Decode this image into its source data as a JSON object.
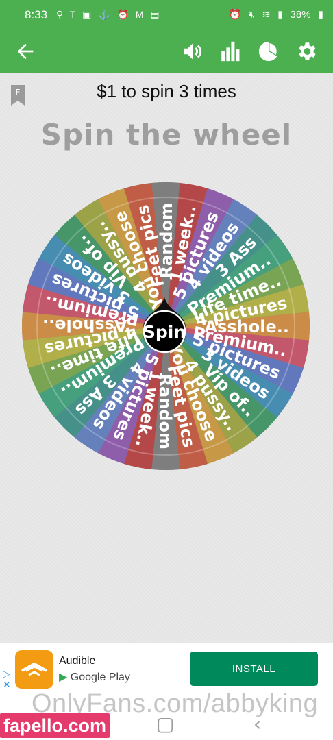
{
  "status_bar": {
    "time": "8:33",
    "notification_icons": [
      "link-icon",
      "tmobile-icon",
      "photo-icon",
      "ship-icon",
      "alarm-icon",
      "gmail-icon",
      "gallery-icon"
    ],
    "system_icons": [
      "alarm-icon",
      "mute-icon",
      "wifi-icon",
      "signal-icon"
    ],
    "battery": "38%"
  },
  "app_bar": {
    "accent": "#4caf50",
    "icons": [
      "back-arrow-icon",
      "volume-icon",
      "bar-chart-icon",
      "pie-chart-icon",
      "gear-icon"
    ]
  },
  "main": {
    "prize_title": "$1 to spin 3 times",
    "heading": "Spin the wheel",
    "spin_label": "Spin",
    "segments": [
      {
        "label": "Random",
        "color": "#7b7b7b"
      },
      {
        "label": "1 week..",
        "color": "#bb3b3c"
      },
      {
        "label": "5 pictures",
        "color": "#8e56b0"
      },
      {
        "label": "4 videos",
        "color": "#5e7fc4"
      },
      {
        "label": "3 Ass",
        "color": "#3a9189"
      },
      {
        "label": "Premium..",
        "color": "#3aa37a"
      },
      {
        "label": "Life time..",
        "color": "#76a84a"
      },
      {
        "label": "4 pictures",
        "color": "#b7b53d"
      },
      {
        "label": "Asshole..",
        "color": "#d58c3a"
      },
      {
        "label": "Premium..",
        "color": "#cc4d66"
      },
      {
        "label": "5 pictures",
        "color": "#5a74c4"
      },
      {
        "label": "3 videos",
        "color": "#3b8db7"
      },
      {
        "label": "Vip of..",
        "color": "#3a9863"
      },
      {
        "label": "4 pussy..",
        "color": "#9ea63c"
      },
      {
        "label": "You choose",
        "color": "#d19a3a"
      },
      {
        "label": "Feet pics",
        "color": "#c9553a"
      }
    ]
  },
  "ad": {
    "app_name": "Audible",
    "store": "Google Play",
    "install_label": "INSTALL",
    "button_color": "#008a5c"
  },
  "overlays": {
    "watermark": "OnlyFans.com/abbyking",
    "badge": "fapello.com"
  }
}
